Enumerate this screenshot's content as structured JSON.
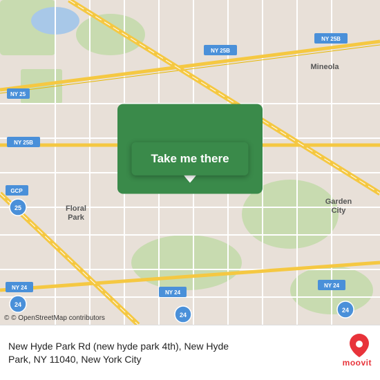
{
  "map": {
    "background_color": "#e8e0d8",
    "center_lat": 40.7282,
    "center_lng": -73.6876
  },
  "pin": {
    "visible": true
  },
  "button": {
    "label": "Take me there"
  },
  "footer": {
    "osm_text": "© OpenStreetMap contributors",
    "address_line1": "New Hyde Park Rd (new hyde park 4th), New Hyde",
    "address_line2": "Park, NY 11040, New York City",
    "moovit_label": "moovit"
  },
  "road_labels": [
    {
      "id": "ny25b-top",
      "text": "NY 25B"
    },
    {
      "id": "ny25b-mid",
      "text": "NY 25B"
    },
    {
      "id": "ny25b-left",
      "text": "NY 25B"
    },
    {
      "id": "ny25",
      "text": "NY 25"
    },
    {
      "id": "ny24-left",
      "text": "NY 24"
    },
    {
      "id": "ny24-mid",
      "text": "NY 24"
    },
    {
      "id": "ny24-right",
      "text": "NY 24"
    },
    {
      "id": "gcp",
      "text": "GCP"
    },
    {
      "id": "i25",
      "text": "25"
    },
    {
      "id": "i24l",
      "text": "24"
    },
    {
      "id": "i24r",
      "text": "24"
    }
  ],
  "place_labels": [
    {
      "id": "floral-park",
      "text": "Floral\nPark"
    },
    {
      "id": "mineola",
      "text": "Mineola"
    },
    {
      "id": "garden-city",
      "text": "Garden\nCity"
    }
  ]
}
